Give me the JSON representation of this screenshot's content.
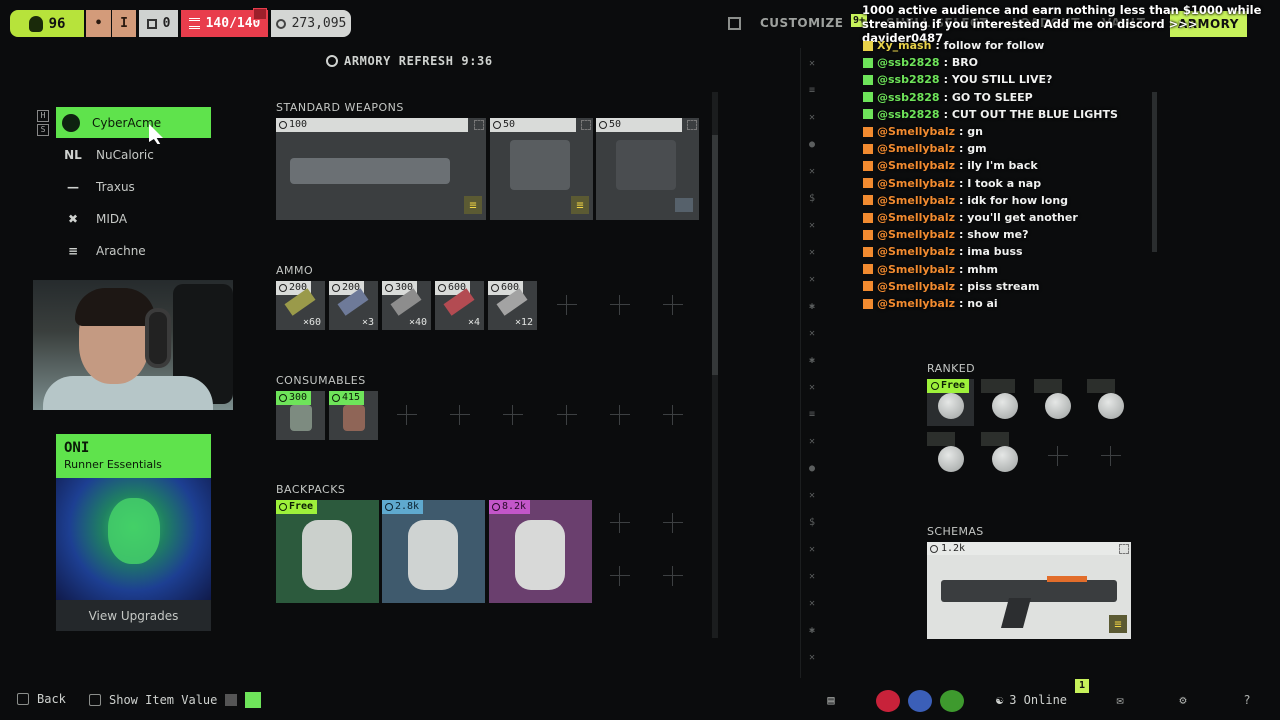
{
  "topbar": {
    "level": "96",
    "tool1": "•",
    "tool2": "I",
    "tool3": "0",
    "stash": "140/140",
    "credits": "273,095",
    "tabs": {
      "customize": "CUSTOMIZE",
      "shell": "SHELL SELECT",
      "loadout": "LOADOUT",
      "vault": "VAULT",
      "armory": "ARMORY"
    },
    "notif_count": "9+"
  },
  "refresh_label": "ARMORY REFRESH 9:36",
  "factions": [
    {
      "name": "CyberAcme",
      "icon": "cyberacme-icon"
    },
    {
      "name": "NuCaloric",
      "icon": "nucaloric-icon"
    },
    {
      "name": "Traxus",
      "icon": "traxus-icon"
    },
    {
      "name": "MIDA",
      "icon": "mida-icon"
    },
    {
      "name": "Arachne",
      "icon": "arachne-icon"
    }
  ],
  "side_keys": [
    "H",
    "S"
  ],
  "oni": {
    "title": "ONI",
    "subtitle": "Runner Essentials",
    "button": "View Upgrades"
  },
  "sections": {
    "weapons": "STANDARD WEAPONS",
    "ammo": "AMMO",
    "consumables": "CONSUMABLES",
    "backpacks": "BACKPACKS",
    "ranked": "RANKED",
    "schemas": "SCHEMAS"
  },
  "weapons": [
    {
      "price": "100"
    },
    {
      "price": "50"
    },
    {
      "price": "50"
    }
  ],
  "ammo": [
    {
      "price": "200",
      "qty": "×60"
    },
    {
      "price": "200",
      "qty": "×3"
    },
    {
      "price": "300",
      "qty": "×40"
    },
    {
      "price": "600",
      "qty": "×4"
    },
    {
      "price": "600",
      "qty": "×12"
    }
  ],
  "consumables": [
    {
      "price": "300"
    },
    {
      "price": "415"
    }
  ],
  "backpacks": [
    {
      "price": "Free"
    },
    {
      "price": "2.8k"
    },
    {
      "price": "8.2k"
    }
  ],
  "ranked": [
    {
      "price": "Free"
    }
  ],
  "schema": {
    "price": "1.2k"
  },
  "chat": {
    "banner": "1000 active audience and earn nothing less than $1000 while streaming if you interested Add me on discord >>> davider0487",
    "lines": [
      {
        "user": "Xy_mash",
        "msg": ": follow for follow",
        "color": "#e8d24a"
      },
      {
        "user": "@ssb2828",
        "msg": ": BRO",
        "color": "#6ee45a"
      },
      {
        "user": "@ssb2828",
        "msg": ": YOU STILL LIVE?",
        "color": "#6ee45a"
      },
      {
        "user": "@ssb2828",
        "msg": ": GO TO SLEEP",
        "color": "#6ee45a"
      },
      {
        "user": "@ssb2828",
        "msg": ": CUT OUT THE BLUE LIGHTS",
        "color": "#6ee45a"
      },
      {
        "user": "@Smellybalz",
        "msg": ": gn",
        "color": "#f28b30"
      },
      {
        "user": "@Smellybalz",
        "msg": ": gm",
        "color": "#f28b30"
      },
      {
        "user": "@Smellybalz",
        "msg": ": ily I'm back",
        "color": "#f28b30"
      },
      {
        "user": "@Smellybalz",
        "msg": ": I took a nap",
        "color": "#f28b30"
      },
      {
        "user": "@Smellybalz",
        "msg": ": idk for how long",
        "color": "#f28b30"
      },
      {
        "user": "@Smellybalz",
        "msg": ": you'll get another",
        "color": "#f28b30"
      },
      {
        "user": "@Smellybalz",
        "msg": ": show me?",
        "color": "#f28b30"
      },
      {
        "user": "@Smellybalz",
        "msg": ": ima buss",
        "color": "#f28b30"
      },
      {
        "user": "@Smellybalz",
        "msg": ": mhm",
        "color": "#f28b30"
      },
      {
        "user": "@Smellybalz",
        "msg": ": piss stream",
        "color": "#f28b30"
      },
      {
        "user": "@Smellybalz",
        "msg": ": no ai",
        "color": "#f28b30"
      }
    ]
  },
  "bottombar": {
    "back": "Back",
    "show_item_value": "Show Item Value",
    "online": "3 Online",
    "online_badge": "1"
  },
  "colors": {
    "accent_green": "#5fe34c",
    "lime": "#c7f25b",
    "stash_red": "#e83d4c"
  }
}
